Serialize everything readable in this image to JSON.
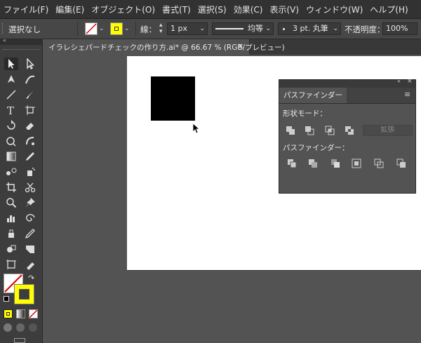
{
  "menu": [
    "ファイル(F)",
    "編集(E)",
    "オブジェクト(O)",
    "書式(T)",
    "選択(S)",
    "効果(C)",
    "表示(V)",
    "ウィンドウ(W)",
    "ヘルプ(H)"
  ],
  "control_bar": {
    "selection_status": "選択なし",
    "stroke_label": "線：",
    "stroke_weight": "1 px",
    "profile_label": "均等",
    "brush_label": "3 pt. 丸筆",
    "opacity_label": "不透明度：",
    "opacity_value": "100%"
  },
  "document_tab": {
    "title": "イラレシェパードチェックの作り方.ai* @ 66.67 % (RGB/プレビュー)",
    "close": "×"
  },
  "pathfinder_panel": {
    "tab": "パスファインダー",
    "shape_modes_label": "形状モード：",
    "expand_label": "拡張",
    "pathfinders_label": "パスファインダー："
  },
  "colors": {
    "fill": "#ffff00",
    "artboard": "#ffffff",
    "object": "#000000"
  }
}
